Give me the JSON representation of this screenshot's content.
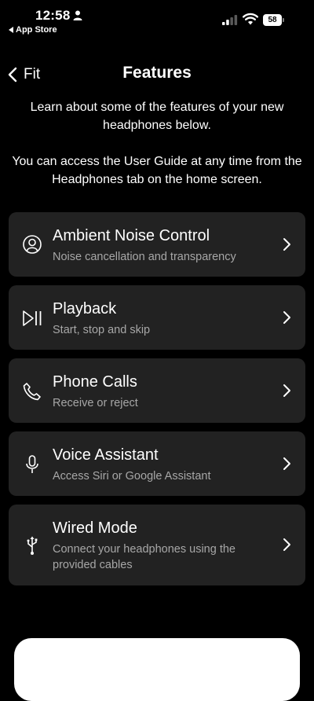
{
  "status_bar": {
    "time": "12:58",
    "back_app": "App Store",
    "battery": "58"
  },
  "nav": {
    "back_label": "Fit",
    "title": "Features"
  },
  "intro": {
    "paragraph1": "Learn about some of the features of your new headphones below.",
    "paragraph2": "You can access the User Guide at any time from the  Headphones tab on the home screen."
  },
  "features": [
    {
      "icon": "ambient-noise-icon",
      "title": "Ambient Noise Control",
      "subtitle": "Noise cancellation and transparency"
    },
    {
      "icon": "play-pause-icon",
      "title": "Playback",
      "subtitle": "Start, stop and skip"
    },
    {
      "icon": "phone-icon",
      "title": "Phone Calls",
      "subtitle": "Receive or reject"
    },
    {
      "icon": "microphone-icon",
      "title": "Voice Assistant",
      "subtitle": "Access Siri or Google Assistant"
    },
    {
      "icon": "usb-icon",
      "title": "Wired Mode",
      "subtitle": "Connect your headphones using the provided cables"
    }
  ],
  "colors": {
    "background": "#000000",
    "card": "#222222",
    "secondary_text": "#a7a7a7"
  }
}
